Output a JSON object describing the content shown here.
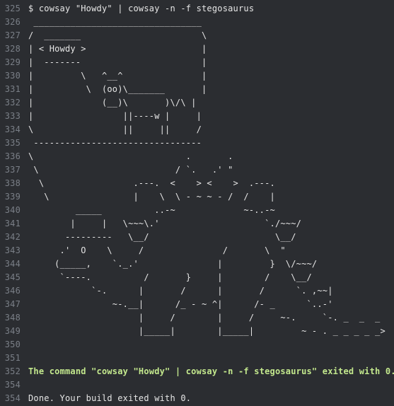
{
  "log_lines": [
    {
      "number": "325",
      "text": "$ cowsay \"Howdy\" | cowsay -n -f stegosaurus",
      "kind": "normal"
    },
    {
      "number": "326",
      "text": " ________________________________",
      "kind": "normal"
    },
    {
      "number": "327",
      "text": "/  _______                       \\",
      "kind": "normal"
    },
    {
      "number": "328",
      "text": "| < Howdy >                      |",
      "kind": "normal"
    },
    {
      "number": "329",
      "text": "|  -------                       |",
      "kind": "normal"
    },
    {
      "number": "330",
      "text": "|         \\   ^__^               |",
      "kind": "normal"
    },
    {
      "number": "331",
      "text": "|          \\  (oo)\\_______       |",
      "kind": "normal"
    },
    {
      "number": "332",
      "text": "|             (__)\\       )\\/\\ |",
      "kind": "normal"
    },
    {
      "number": "333",
      "text": "|                 ||----w |     |",
      "kind": "normal"
    },
    {
      "number": "334",
      "text": "\\                 ||     ||     /",
      "kind": "normal"
    },
    {
      "number": "335",
      "text": " --------------------------------",
      "kind": "normal"
    },
    {
      "number": "336",
      "text": "\\                             .       .",
      "kind": "normal"
    },
    {
      "number": "337",
      "text": " \\                          / `.   .' \"",
      "kind": "normal"
    },
    {
      "number": "338",
      "text": "  \\                 .---.  <    > <    >  .---.",
      "kind": "normal"
    },
    {
      "number": "339",
      "text": "   \\                |    \\  \\ - ~ ~ - /  /    |",
      "kind": "normal"
    },
    {
      "number": "340",
      "text": "         _____          ..-~             ~-..-~",
      "kind": "normal"
    },
    {
      "number": "341",
      "text": "        |     |   \\~~~\\.'                    `./~~~/",
      "kind": "normal"
    },
    {
      "number": "342",
      "text": "       ---------   \\__/                        \\__/",
      "kind": "normal"
    },
    {
      "number": "343",
      "text": "      .'  O    \\     /               /       \\  \"",
      "kind": "normal"
    },
    {
      "number": "344",
      "text": "     (_____,    `._.'               |         }  \\/~~~/",
      "kind": "normal"
    },
    {
      "number": "345",
      "text": "      `----.          /       }     |        /    \\__/",
      "kind": "normal"
    },
    {
      "number": "346",
      "text": "            `-.      |       /      |       /      `. ,~~|",
      "kind": "normal"
    },
    {
      "number": "347",
      "text": "                ~-.__|      /_ - ~ ^|      /- _      `..-'",
      "kind": "normal"
    },
    {
      "number": "348",
      "text": "                     |     /        |     /     ~-.     `-. _  _  _",
      "kind": "normal"
    },
    {
      "number": "349",
      "text": "                     |_____|        |_____|         ~ - . _ _ _ _ _>",
      "kind": "normal"
    },
    {
      "number": "350",
      "text": "",
      "kind": "normal"
    },
    {
      "number": "351",
      "text": "",
      "kind": "normal"
    },
    {
      "number": "352",
      "text": "The command \"cowsay \"Howdy\" | cowsay -n -f stegosaurus\" exited with 0.",
      "kind": "success"
    },
    {
      "number": "354",
      "text": "",
      "kind": "normal"
    },
    {
      "number": "354",
      "text": "Done. Your build exited with 0.",
      "kind": "normal"
    }
  ]
}
